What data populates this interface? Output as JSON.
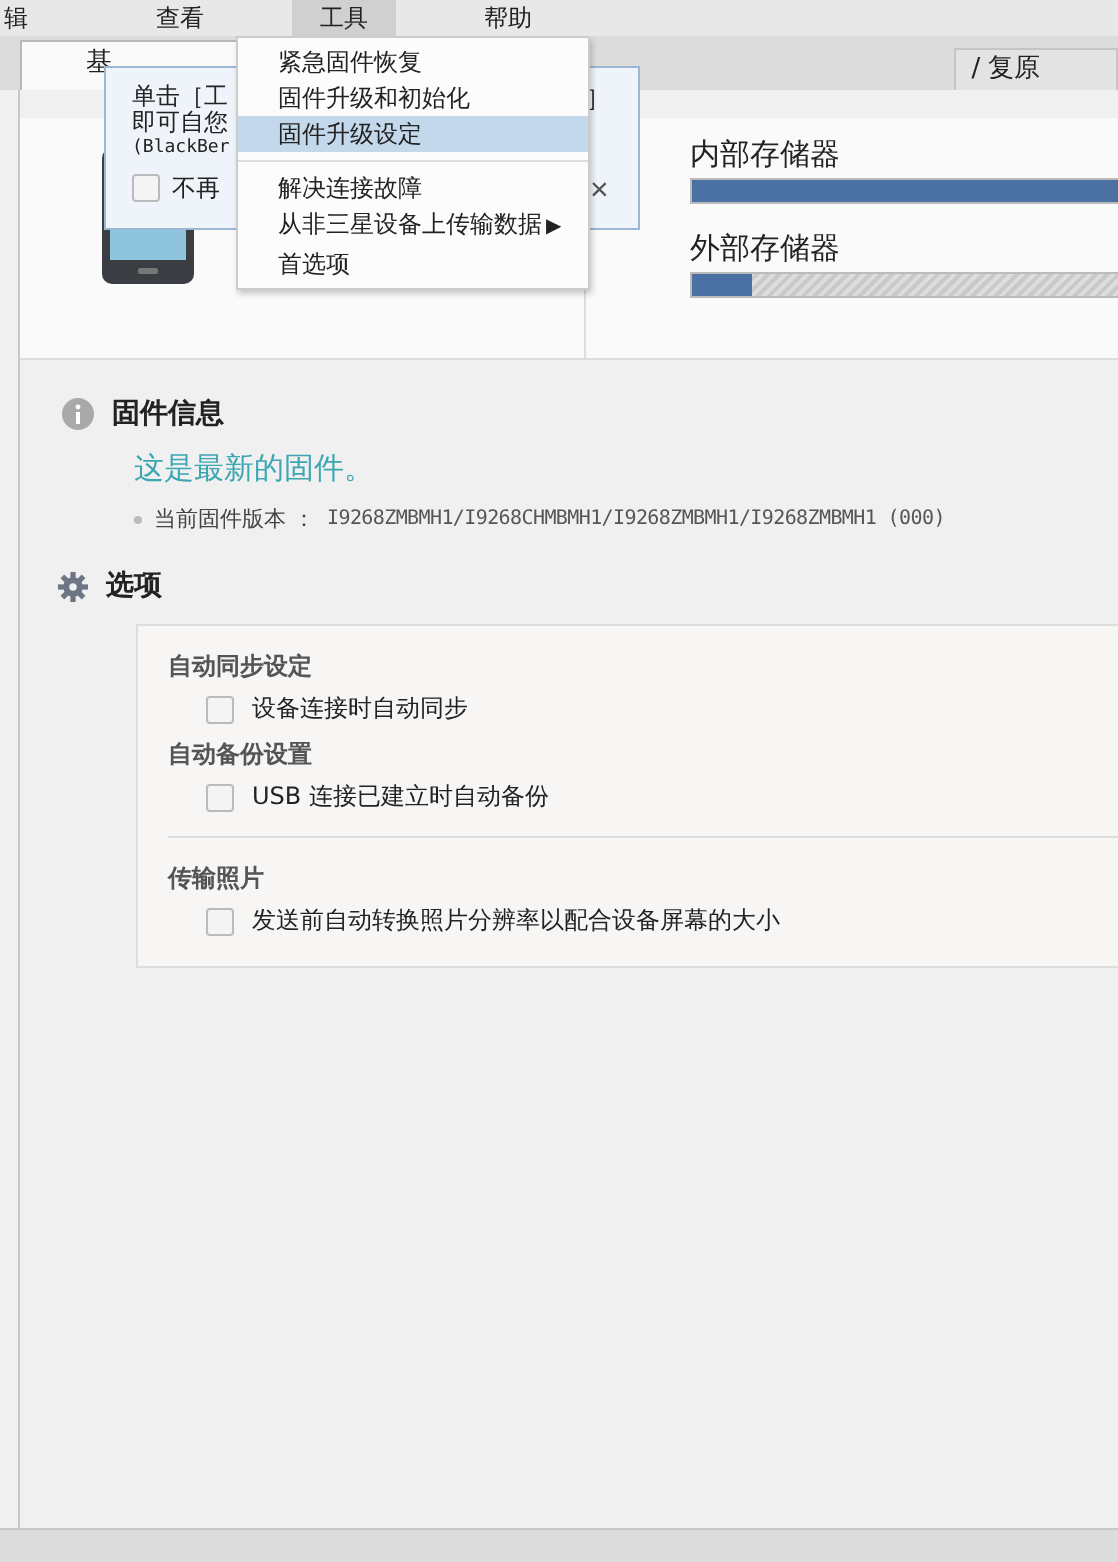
{
  "menu_bar": [
    {
      "label": "辑",
      "selected": false
    },
    {
      "label": "查看",
      "selected": false
    },
    {
      "label": "工具",
      "selected": true
    },
    {
      "label": "帮助",
      "selected": false
    }
  ],
  "tabs": [
    {
      "label": "基",
      "selected": true
    },
    {
      "label": "/ 复原",
      "selected": false
    }
  ],
  "tooltip": {
    "lines": [
      "单击［工",
      "即可自您",
      "(BlackBer"
    ],
    "bracket": "］",
    "checkbox": {
      "label": "不再",
      "checked": false
    },
    "close": "×"
  },
  "dropdown_menu": {
    "items": [
      {
        "label": "紧急固件恢复",
        "selected": false,
        "submenu": false
      },
      {
        "label": "固件升级和初始化",
        "selected": false,
        "submenu": false
      },
      {
        "label": "固件升级设定",
        "selected": true,
        "submenu": false
      },
      {
        "kind": "separator"
      },
      {
        "label": "解决连接故障",
        "selected": false,
        "submenu": false
      },
      {
        "label": "从非三星设备上传输数据",
        "selected": false,
        "submenu": true,
        "arrow": "▶"
      },
      {
        "label": "首选项",
        "selected": false,
        "submenu": false
      }
    ]
  },
  "storage": [
    {
      "label": "内部存储器",
      "level": 0.97
    },
    {
      "label": "外部存储器",
      "level": 0.13
    }
  ],
  "firmware_info": {
    "title": "固件信息",
    "status": "这是最新的固件。",
    "version_label": "当前固件版本 ：",
    "version": "I9268ZMBMH1/I9268CHMBMH1/I9268ZMBMH1/I9268ZMBMH1 (000)"
  },
  "options": {
    "title": "选项",
    "groups": [
      {
        "heading": "自动同步设定",
        "options": [
          {
            "label": "设备连接时自动同步",
            "checked": false
          }
        ]
      },
      {
        "heading": "自动备份设置",
        "options": [
          {
            "label": "USB 连接已建立时自动备份",
            "checked": false
          }
        ]
      },
      {
        "heading": "传输照片",
        "options": [
          {
            "label": "发送前自动转换照片分辨率以配合设备屏幕的大小",
            "checked": false
          }
        ]
      }
    ]
  }
}
